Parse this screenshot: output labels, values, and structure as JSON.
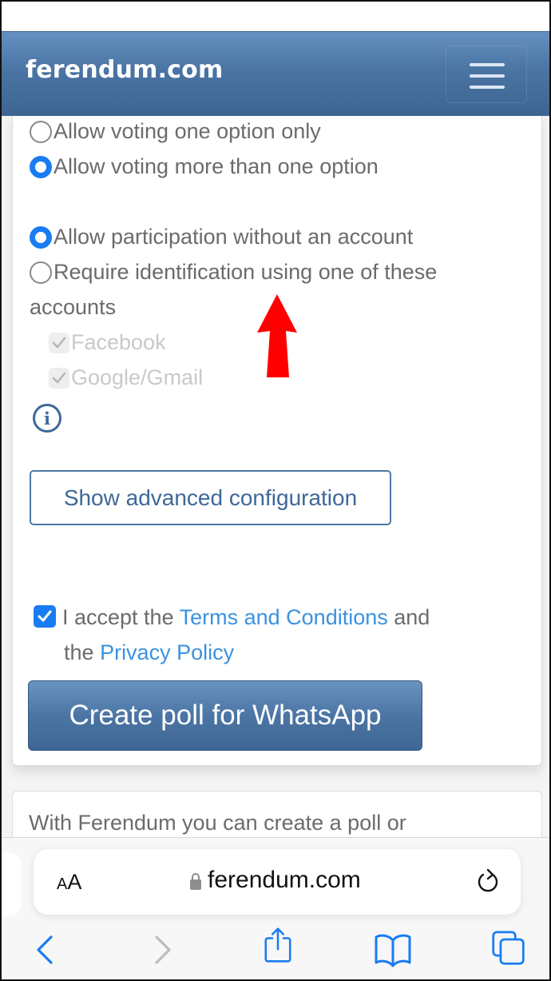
{
  "navbar": {
    "brand": "ferendum.com",
    "menu_icon": "hamburger-menu-icon"
  },
  "voting_options": [
    {
      "label": "Allow voting one option only",
      "selected": false
    },
    {
      "label": "Allow voting more than one option",
      "selected": true
    }
  ],
  "participation_options": [
    {
      "label": "Allow participation without an account",
      "selected": true
    },
    {
      "label": "Require identification using one of these",
      "label_continued": "accounts",
      "selected": false
    }
  ],
  "account_types": [
    {
      "label": "Facebook",
      "checked": true,
      "disabled": true
    },
    {
      "label": "Google/Gmail",
      "checked": true,
      "disabled": true
    }
  ],
  "info_icon": "info-icon",
  "advanced_button": "Show advanced configuration",
  "terms": {
    "checked": true,
    "prefix": "I accept the",
    "terms_link": "Terms and Conditions",
    "middle": "and",
    "line2_prefix": "the",
    "privacy_link": "Privacy Policy"
  },
  "create_button": "Create poll for WhatsApp",
  "intro_text": "With Ferendum you can create a poll or",
  "annotation": {
    "type": "arrow-up",
    "color": "#ff0000"
  },
  "browser": {
    "text_size_label_small": "A",
    "text_size_label_large": "A",
    "url": "ferendum.com",
    "toolbar": [
      "back",
      "forward",
      "share",
      "bookmarks",
      "tabs"
    ]
  },
  "colors": {
    "accent": "#1a7cf2",
    "brand_blue": "#4a74a3",
    "link": "#3a92e0",
    "safari_blue": "#1a7cf2"
  }
}
